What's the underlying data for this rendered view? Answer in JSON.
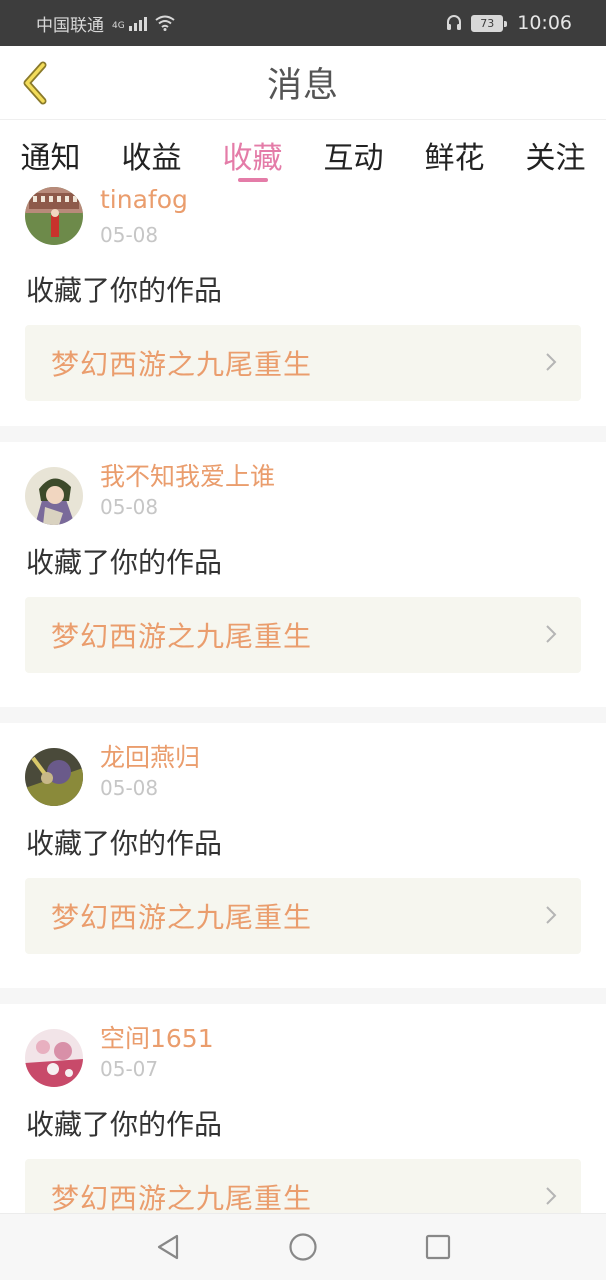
{
  "status_bar": {
    "carrier": "中国联通",
    "network": "4G",
    "battery": "73",
    "time": "10:06",
    "icons": [
      "signal-icon",
      "wifi-icon",
      "headset-icon",
      "battery-icon"
    ]
  },
  "header": {
    "title": "消息",
    "back_icon": "chevron-left-icon"
  },
  "tabs": [
    {
      "label": "通知",
      "active": false
    },
    {
      "label": "收益",
      "active": false
    },
    {
      "label": "收藏",
      "active": true
    },
    {
      "label": "互动",
      "active": false
    },
    {
      "label": "鲜花",
      "active": false
    },
    {
      "label": "关注",
      "active": false
    }
  ],
  "messages": [
    {
      "username": "tinafog",
      "date": "05-08",
      "action": "收藏了你的作品",
      "work_title": "梦幻西游之九尾重生"
    },
    {
      "username": "我不知我爱上谁",
      "date": "05-08",
      "action": "收藏了你的作品",
      "work_title": "梦幻西游之九尾重生"
    },
    {
      "username": "龙回燕归",
      "date": "05-08",
      "action": "收藏了你的作品",
      "work_title": "梦幻西游之九尾重生"
    },
    {
      "username": "空间1651",
      "date": "05-07",
      "action": "收藏了你的作品",
      "work_title": "梦幻西游之九尾重生"
    }
  ],
  "nav_bar": {
    "icons": [
      "back-triangle-icon",
      "home-circle-icon",
      "recents-square-icon"
    ]
  },
  "colors": {
    "accent": "#e47ca8",
    "username": "#ea9d6d",
    "link_bg": "#f6f6ef",
    "status_bar": "#3d3d3d"
  }
}
